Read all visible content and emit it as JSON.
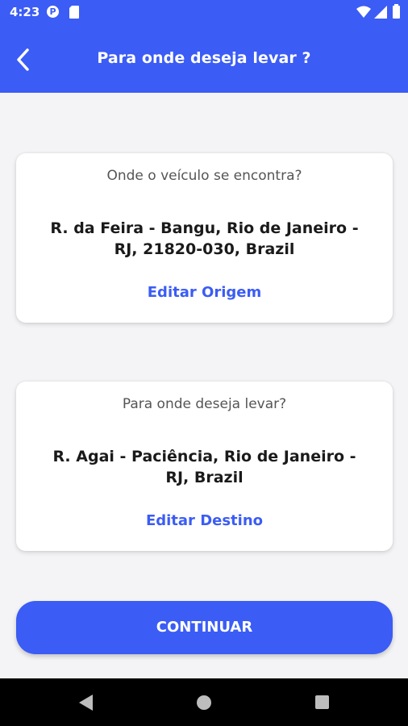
{
  "status_bar": {
    "time": "4:23",
    "icons": [
      "p-notification-icon",
      "sd-card-icon",
      "wifi-icon",
      "signal-icon",
      "battery-icon"
    ]
  },
  "app_bar": {
    "title": "Para onde deseja levar ?",
    "back_icon": "chevron-left-icon"
  },
  "origin_card": {
    "question": "Onde o veículo se encontra?",
    "address": "R. da Feira - Bangu, Rio de Janeiro - RJ, 21820-030, Brazil",
    "edit_label": "Editar Origem"
  },
  "destination_card": {
    "question": "Para onde deseja levar?",
    "address": "R. Agai - Paciência, Rio de Janeiro - RJ, Brazil",
    "edit_label": "Editar Destino"
  },
  "continue_button": {
    "label": "CONTINUAR"
  },
  "nav_bar": {
    "icons": [
      "nav-back-icon",
      "nav-home-icon",
      "nav-recents-icon"
    ]
  },
  "colors": {
    "primary": "#3b5cf5",
    "background": "#f4f4f6",
    "card": "#ffffff",
    "text_dark": "#1a1a1a",
    "text_muted": "#555555"
  }
}
